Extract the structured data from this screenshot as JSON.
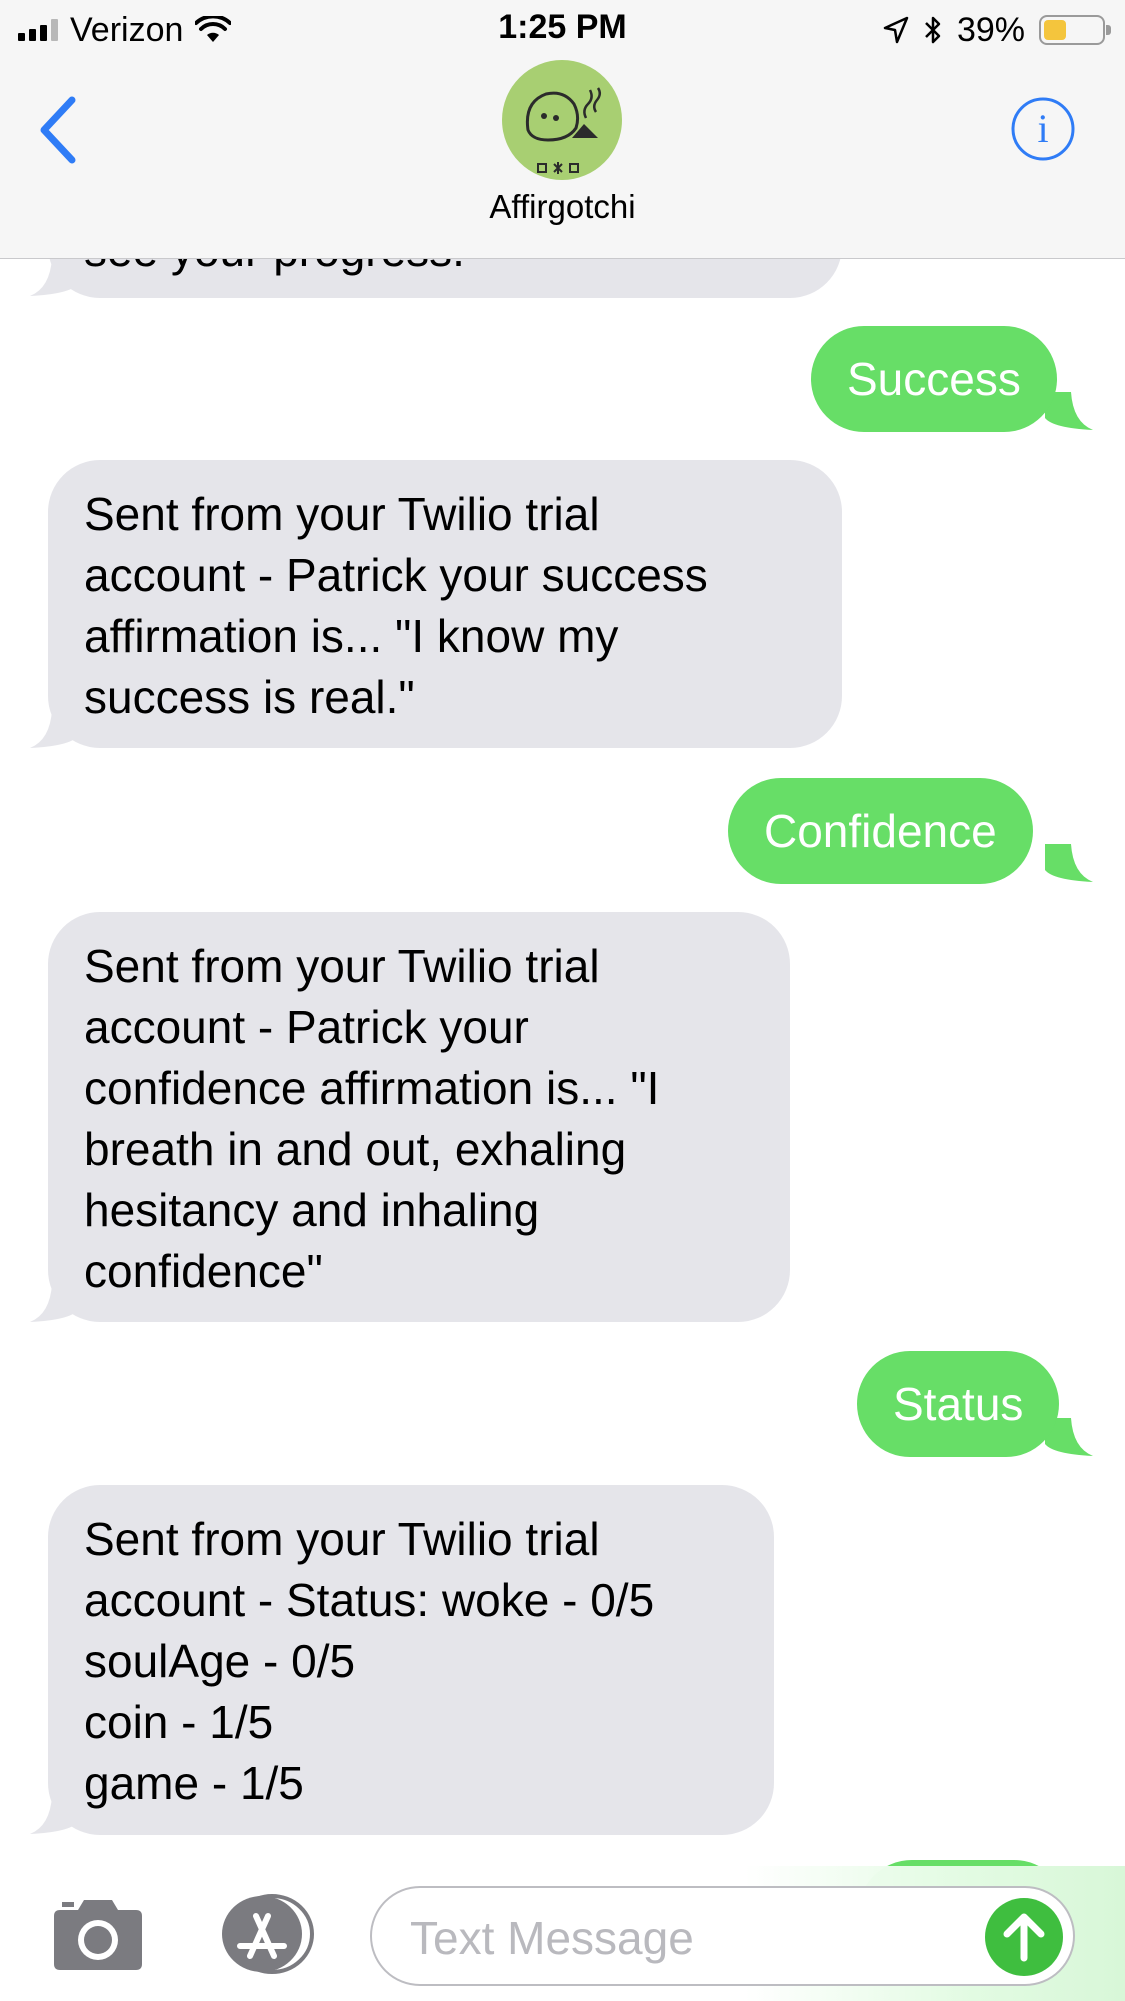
{
  "status_bar": {
    "carrier": "Verizon",
    "time": "1:25 PM",
    "battery_percent": "39%",
    "battery_level": 0.39
  },
  "header": {
    "contact_name": "Affirgotchi",
    "back_icon": "chevron-left-icon",
    "info_icon": "info-icon"
  },
  "messages": [
    {
      "direction": "incoming",
      "lines": [
        "see your progress."
      ]
    },
    {
      "direction": "outgoing",
      "lines": [
        "Success"
      ]
    },
    {
      "direction": "incoming",
      "lines": [
        "Sent from your Twilio trial",
        "account - Patrick your success",
        "affirmation is... \"I know my",
        "success is real.\""
      ]
    },
    {
      "direction": "outgoing",
      "lines": [
        "Confidence"
      ]
    },
    {
      "direction": "incoming",
      "lines": [
        "Sent from your Twilio trial",
        "account - Patrick your",
        "confidence affirmation is... \"I",
        "breath in and out, exhaling",
        "hesitancy and inhaling",
        "confidence\""
      ]
    },
    {
      "direction": "outgoing",
      "lines": [
        "Status"
      ]
    },
    {
      "direction": "incoming",
      "lines": [
        "Sent from your Twilio trial",
        "account - Status: woke - 0/5",
        "soulAge - 0/5",
        "coin - 1/5",
        "game - 1/5"
      ]
    }
  ],
  "input_bar": {
    "placeholder": "Text Message",
    "camera_icon": "camera-icon",
    "apps_icon": "app-store-icon",
    "send_icon": "send-arrow-icon"
  },
  "colors": {
    "incoming_bubble": "#e5e5ea",
    "outgoing_bubble": "#67de67",
    "accent_blue": "#2f7cf6",
    "send_button": "#3fbe3f"
  }
}
